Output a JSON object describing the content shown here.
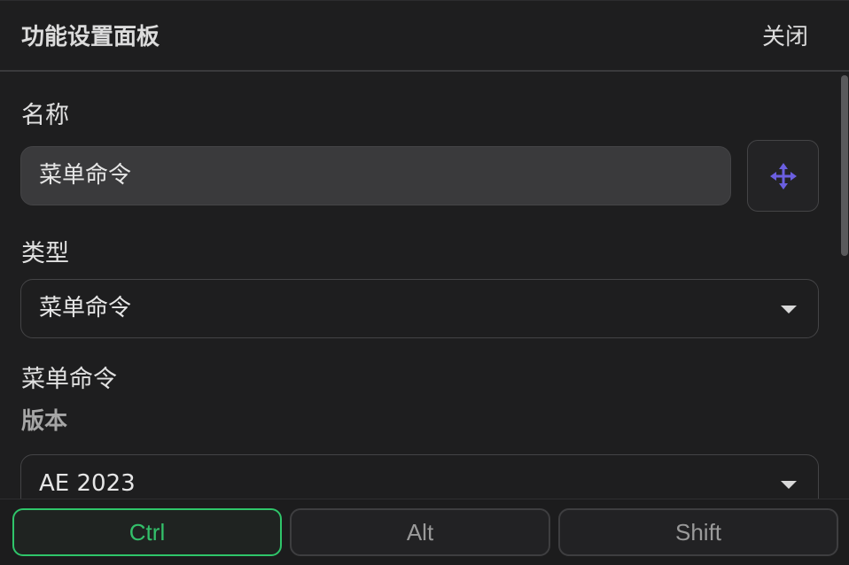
{
  "header": {
    "title": "功能设置面板",
    "close_label": "关闭"
  },
  "form": {
    "name_label": "名称",
    "name_value": "菜单命令",
    "type_label": "类型",
    "type_value": "菜单命令",
    "section_title": "菜单命令",
    "version_label": "版本",
    "version_value": "AE 2023"
  },
  "icons": {
    "move": "move-arrows-icon",
    "caret": "chevron-down-icon"
  },
  "footer": {
    "modifiers": [
      {
        "label": "Ctrl",
        "active": true
      },
      {
        "label": "Alt",
        "active": false
      },
      {
        "label": "Shift",
        "active": false
      }
    ]
  },
  "colors": {
    "accent_active": "#33c06a",
    "move_icon": "#6b5fe0",
    "background": "#1e1e1f"
  }
}
